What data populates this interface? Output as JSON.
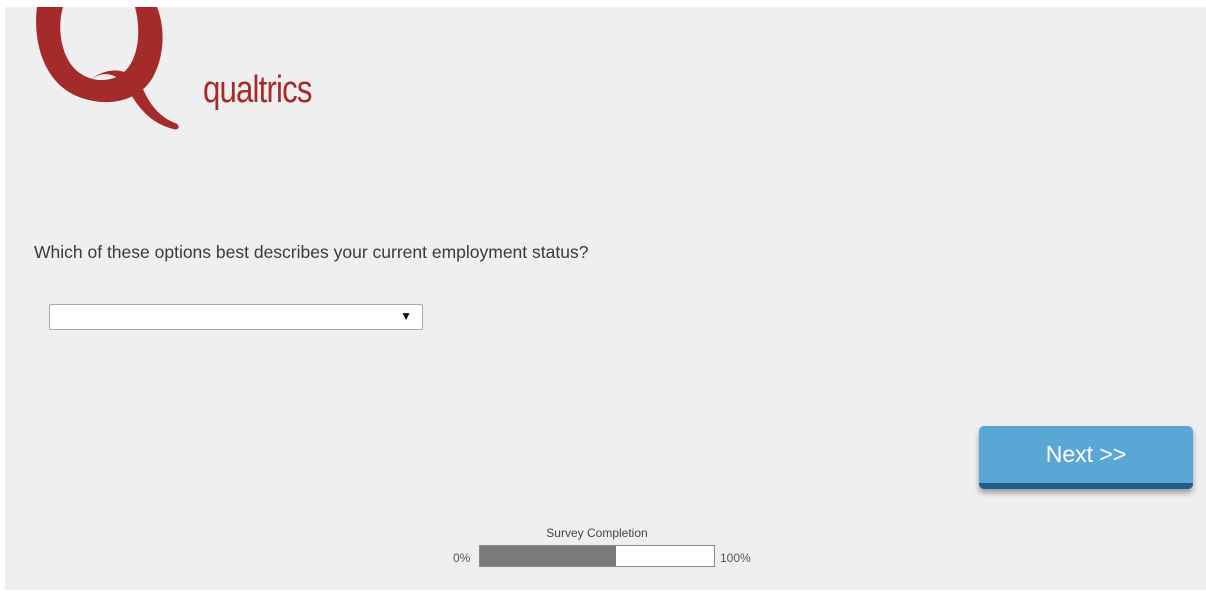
{
  "brand": {
    "name": "qualtrics",
    "color": "#a52a2a"
  },
  "question": {
    "text": "Which of these options best describes your current employment status?",
    "dropdown_value": ""
  },
  "navigation": {
    "next_label": "Next >>"
  },
  "progress": {
    "label": "Survey Completion",
    "start_label": "0%",
    "end_label": "100%",
    "value": 0.58
  },
  "colors": {
    "background": "#efefef",
    "button": "#5aa7d5",
    "button_shadow": "#1d5f8c",
    "progress_fill": "#7b7b7b"
  }
}
